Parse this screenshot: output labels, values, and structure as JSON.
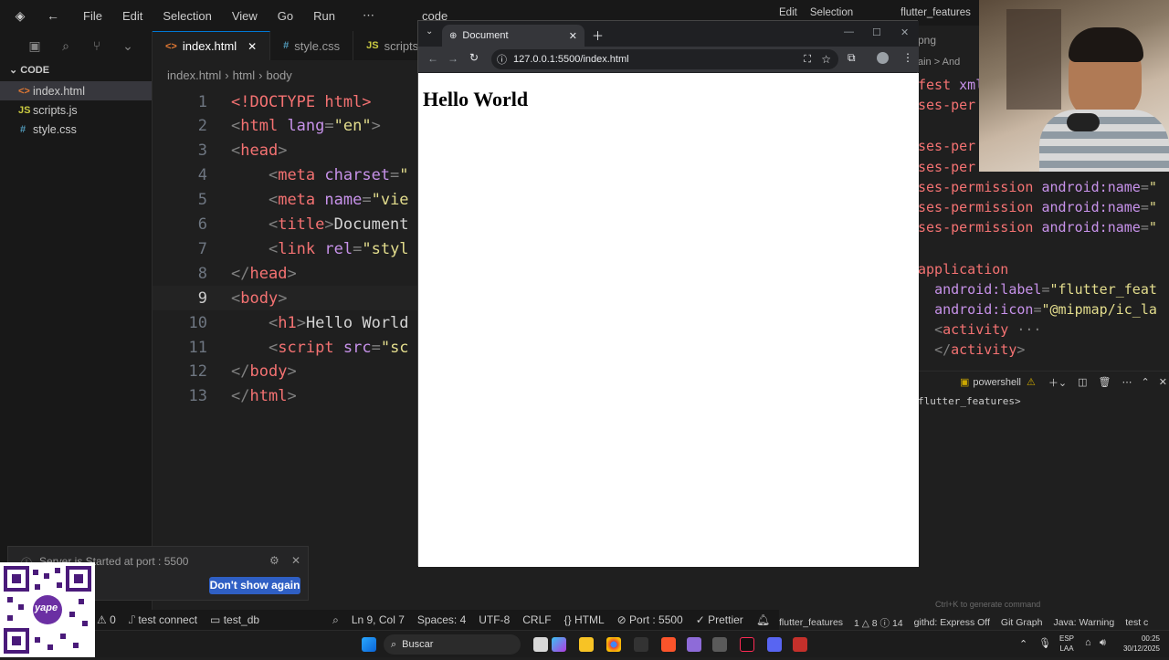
{
  "left_editor": {
    "title_menu": [
      "File",
      "Edit",
      "Selection",
      "View",
      "Go",
      "Run"
    ],
    "window_title": "code",
    "explorer_title": "CODE",
    "files": [
      {
        "name": "index.html",
        "type": "html",
        "selected": true
      },
      {
        "name": "scripts.js",
        "type": "js",
        "selected": false
      },
      {
        "name": "style.css",
        "type": "css",
        "selected": false
      }
    ],
    "tabs": [
      {
        "label": "index.html",
        "active": true
      },
      {
        "label": "style.css",
        "active": false
      },
      {
        "label": "scripts.js",
        "active": false
      }
    ],
    "breadcrumbs": [
      "index.html",
      "html",
      "body"
    ],
    "code_lines": [
      {
        "n": "1",
        "parts": [
          [
            "tg",
            "<!DOCTYPE html>"
          ]
        ]
      },
      {
        "n": "2",
        "parts": [
          [
            "pu",
            "<"
          ],
          [
            "tg",
            "html "
          ],
          [
            "at",
            "lang"
          ],
          [
            "pu",
            "="
          ],
          [
            "st",
            "\"en\""
          ],
          [
            "pu",
            ">"
          ]
        ]
      },
      {
        "n": "3",
        "parts": [
          [
            "pu",
            "<"
          ],
          [
            "tg",
            "head"
          ],
          [
            "pu",
            ">"
          ]
        ]
      },
      {
        "n": "4",
        "parts": [
          [
            "tx",
            "    "
          ],
          [
            "pu",
            "<"
          ],
          [
            "tg",
            "meta "
          ],
          [
            "at",
            "charset"
          ],
          [
            "pu",
            "="
          ],
          [
            "st",
            "\""
          ]
        ]
      },
      {
        "n": "5",
        "parts": [
          [
            "tx",
            "    "
          ],
          [
            "pu",
            "<"
          ],
          [
            "tg",
            "meta "
          ],
          [
            "at",
            "name"
          ],
          [
            "pu",
            "="
          ],
          [
            "st",
            "\"vie"
          ]
        ]
      },
      {
        "n": "6",
        "parts": [
          [
            "tx",
            "    "
          ],
          [
            "pu",
            "<"
          ],
          [
            "tg",
            "title"
          ],
          [
            "pu",
            ">"
          ],
          [
            "tx",
            "Document"
          ]
        ]
      },
      {
        "n": "7",
        "parts": [
          [
            "tx",
            "    "
          ],
          [
            "pu",
            "<"
          ],
          [
            "tg",
            "link "
          ],
          [
            "at",
            "rel"
          ],
          [
            "pu",
            "="
          ],
          [
            "st",
            "\"styl"
          ]
        ]
      },
      {
        "n": "8",
        "parts": [
          [
            "pu",
            "</"
          ],
          [
            "tg",
            "head"
          ],
          [
            "pu",
            ">"
          ]
        ]
      },
      {
        "n": "9",
        "parts": [
          [
            "pu",
            "<"
          ],
          [
            "tg",
            "body"
          ],
          [
            "pu",
            ">"
          ]
        ]
      },
      {
        "n": "10",
        "parts": [
          [
            "tx",
            "    "
          ],
          [
            "pu",
            "<"
          ],
          [
            "tg",
            "h1"
          ],
          [
            "pu",
            ">"
          ],
          [
            "tx",
            "Hello World"
          ]
        ]
      },
      {
        "n": "11",
        "parts": [
          [
            "tx",
            "    "
          ],
          [
            "pu",
            "<"
          ],
          [
            "tg",
            "script "
          ],
          [
            "at",
            "src"
          ],
          [
            "pu",
            "="
          ],
          [
            "st",
            "\"sc"
          ]
        ]
      },
      {
        "n": "12",
        "parts": [
          [
            "pu",
            "</"
          ],
          [
            "tg",
            "body"
          ],
          [
            "pu",
            ">"
          ]
        ]
      },
      {
        "n": "13",
        "parts": [
          [
            "pu",
            "</"
          ],
          [
            "tg",
            "html"
          ],
          [
            "pu",
            ">"
          ]
        ]
      }
    ],
    "notification": {
      "text": "Server is Started at port : 5500",
      "button": "Don't show again"
    },
    "status": {
      "problems": "0",
      "connect": "test connect",
      "db": "test_db",
      "cursor": "Ln 9, Col 7",
      "spaces": "Spaces: 4",
      "encoding": "UTF-8",
      "eol": "CRLF",
      "language": "HTML",
      "port": "Port : 5500",
      "prettier": "Prettier"
    }
  },
  "browser": {
    "tab_title": "Document",
    "url": "127.0.0.1:5500/index.html",
    "heading": "Hello World"
  },
  "right_editor": {
    "title_menu": [
      "Edit",
      "Selection"
    ],
    "window_title": "flutter_features",
    "tab_fragment": "png",
    "breadcrumb_fragment": "ain > And",
    "code_lines": [
      {
        "parts": [
          [
            "tg",
            "fest "
          ],
          [
            "at",
            "xml"
          ]
        ]
      },
      {
        "parts": [
          [
            "tg",
            "ses-per"
          ]
        ]
      },
      {
        "parts": [
          [
            "tg",
            ""
          ]
        ]
      },
      {
        "parts": [
          [
            "tg",
            "ses-per"
          ]
        ]
      },
      {
        "parts": [
          [
            "tg",
            "ses-per"
          ]
        ]
      },
      {
        "parts": [
          [
            "tg",
            "ses-permission "
          ],
          [
            "at",
            "android:name"
          ],
          [
            "pu",
            "="
          ],
          [
            "st",
            "\""
          ]
        ]
      },
      {
        "parts": [
          [
            "tg",
            "ses-permission "
          ],
          [
            "at",
            "android:name"
          ],
          [
            "pu",
            "="
          ],
          [
            "st",
            "\""
          ]
        ]
      },
      {
        "parts": [
          [
            "tg",
            "ses-permission "
          ],
          [
            "at",
            "android:name"
          ],
          [
            "pu",
            "="
          ],
          [
            "st",
            "\""
          ]
        ]
      },
      {
        "parts": [
          [
            "tg",
            ""
          ]
        ]
      },
      {
        "parts": [
          [
            "tg",
            "application"
          ]
        ]
      },
      {
        "parts": [
          [
            "tx",
            "  "
          ],
          [
            "at",
            "android:label"
          ],
          [
            "pu",
            "="
          ],
          [
            "st",
            "\"flutter_feat"
          ]
        ]
      },
      {
        "parts": [
          [
            "tx",
            "  "
          ],
          [
            "at",
            "android:icon"
          ],
          [
            "pu",
            "="
          ],
          [
            "st",
            "\"@mipmap/ic_la"
          ]
        ]
      },
      {
        "parts": [
          [
            "tx",
            "  "
          ],
          [
            "pu",
            "<"
          ],
          [
            "tg",
            "activity"
          ],
          [
            "pu",
            " ···"
          ]
        ]
      },
      {
        "parts": [
          [
            "tx",
            "  "
          ],
          [
            "pu",
            "</"
          ],
          [
            "tg",
            "activity"
          ],
          [
            "pu",
            ">"
          ]
        ]
      }
    ],
    "terminal_label": "powershell",
    "terminal_prompt": "flutter_features>",
    "hint": "Ctrl+K to generate command",
    "status": {
      "folder": "flutter_features",
      "counts": "1 △ 8 ⓘ 14",
      "githd": "githd: Express Off",
      "gitgraph": "Git Graph",
      "java": "Java: Warning",
      "test": "test c"
    }
  },
  "taskbar": {
    "search_label": "Buscar",
    "lang_top": "ESP",
    "lang_bottom": "LAA",
    "time": "00:25",
    "date": "30/12/2025"
  },
  "qr_label": "yape"
}
